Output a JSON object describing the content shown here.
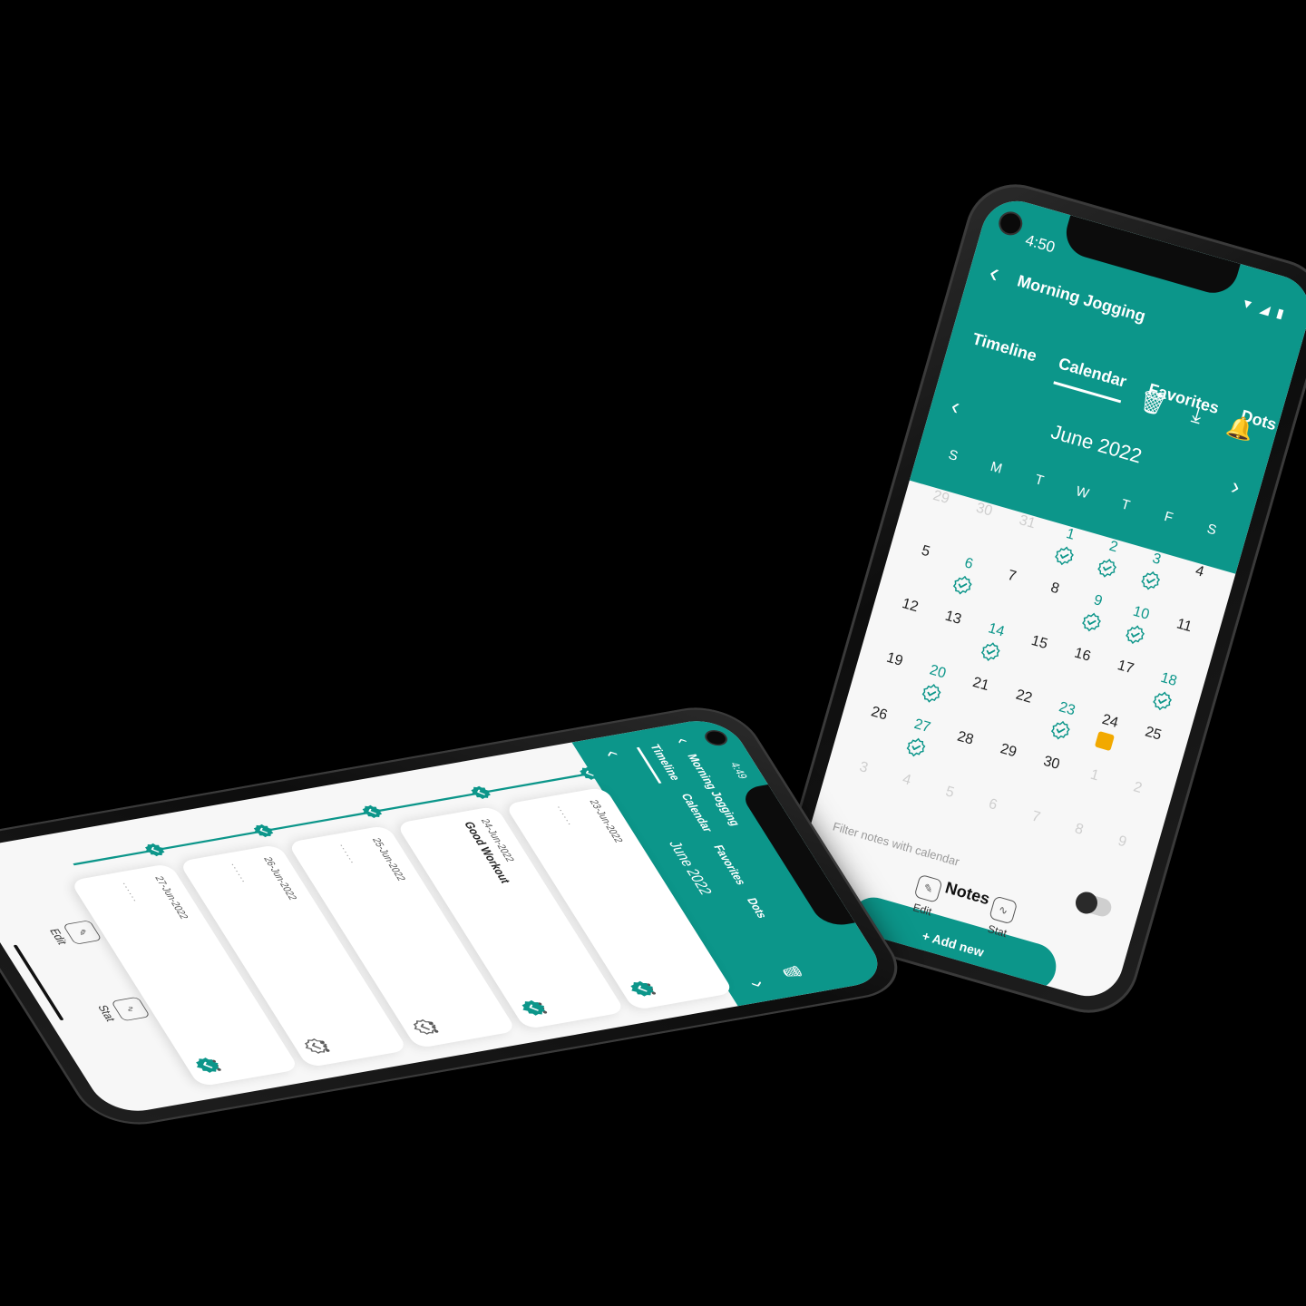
{
  "app": {
    "title": "Morning Jogging",
    "tabs": [
      "Timeline",
      "Calendar",
      "Favorites",
      "Dots"
    ],
    "colors": {
      "accent": "#0c968a",
      "note": "#f2a900",
      "background": "#000000"
    }
  },
  "right_phone": {
    "status_time": "4:50",
    "active_tab": "Calendar",
    "month": "June 2022",
    "weekdays": [
      "S",
      "M",
      "T",
      "W",
      "T",
      "F",
      "S"
    ],
    "days": [
      {
        "d": "29",
        "state": "faded"
      },
      {
        "d": "30",
        "state": "faded"
      },
      {
        "d": "31",
        "state": "faded"
      },
      {
        "d": "1",
        "state": "done"
      },
      {
        "d": "2",
        "state": "done"
      },
      {
        "d": "3",
        "state": "done"
      },
      {
        "d": "4",
        "state": "normal"
      },
      {
        "d": "5",
        "state": "normal"
      },
      {
        "d": "6",
        "state": "done"
      },
      {
        "d": "7",
        "state": "normal"
      },
      {
        "d": "8",
        "state": "normal"
      },
      {
        "d": "9",
        "state": "done"
      },
      {
        "d": "10",
        "state": "done"
      },
      {
        "d": "11",
        "state": "normal"
      },
      {
        "d": "12",
        "state": "normal"
      },
      {
        "d": "13",
        "state": "normal"
      },
      {
        "d": "14",
        "state": "done"
      },
      {
        "d": "15",
        "state": "normal"
      },
      {
        "d": "16",
        "state": "normal"
      },
      {
        "d": "17",
        "state": "normal"
      },
      {
        "d": "18",
        "state": "done"
      },
      {
        "d": "19",
        "state": "normal"
      },
      {
        "d": "20",
        "state": "done"
      },
      {
        "d": "21",
        "state": "normal"
      },
      {
        "d": "22",
        "state": "normal"
      },
      {
        "d": "23",
        "state": "done"
      },
      {
        "d": "24",
        "state": "note"
      },
      {
        "d": "25",
        "state": "normal"
      },
      {
        "d": "26",
        "state": "normal"
      },
      {
        "d": "27",
        "state": "done"
      },
      {
        "d": "28",
        "state": "normal"
      },
      {
        "d": "29",
        "state": "normal"
      },
      {
        "d": "30",
        "state": "normal"
      },
      {
        "d": "1",
        "state": "faded"
      },
      {
        "d": "2",
        "state": "faded"
      },
      {
        "d": "3",
        "state": "faded"
      },
      {
        "d": "4",
        "state": "faded"
      },
      {
        "d": "5",
        "state": "faded"
      },
      {
        "d": "6",
        "state": "faded"
      },
      {
        "d": "7",
        "state": "faded"
      },
      {
        "d": "8",
        "state": "faded"
      },
      {
        "d": "9",
        "state": "faded"
      }
    ],
    "filter_label": "Filter notes with calendar",
    "notes_title": "Notes",
    "add_button": "+ Add new",
    "bottom": {
      "edit": "Edit",
      "stat": "Stat"
    }
  },
  "left_phone": {
    "status_time": "4:49",
    "active_tab": "Timeline",
    "month": "June 2022",
    "entries": [
      {
        "date": "23-Jun-2022",
        "title": "",
        "dots": "......",
        "done": true
      },
      {
        "date": "24-Jun-2022",
        "title": "Good Workout",
        "dots": "",
        "done": true
      },
      {
        "date": "25-Jun-2022",
        "title": "",
        "dots": "......",
        "done": false
      },
      {
        "date": "26-Jun-2022",
        "title": "",
        "dots": "......",
        "done": false
      },
      {
        "date": "27-Jun-2022",
        "title": "",
        "dots": "......",
        "done": true
      }
    ],
    "menu_glyph": "•••",
    "bottom": {
      "edit": "Edit",
      "stat": "Stat"
    }
  }
}
